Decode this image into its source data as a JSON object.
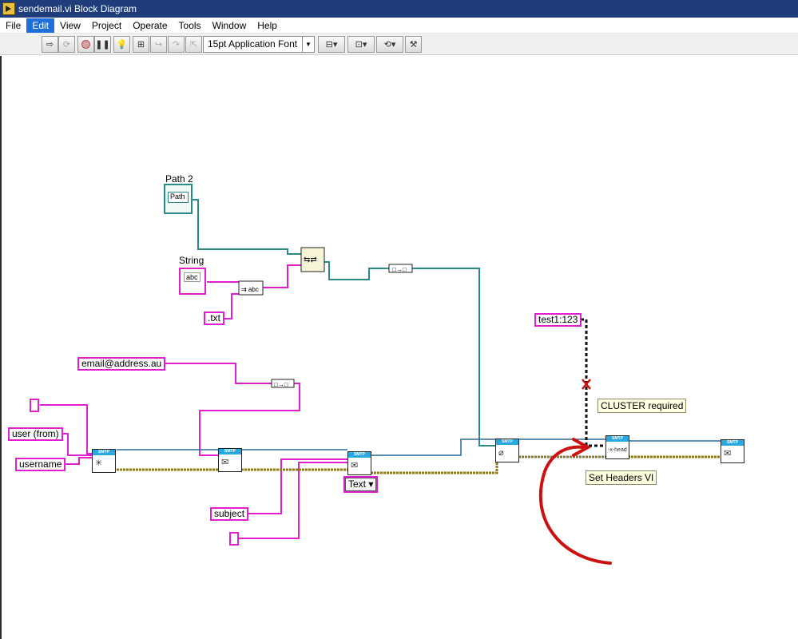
{
  "window": {
    "title": "sendemail.vi Block Diagram"
  },
  "menu": [
    "File",
    "Edit",
    "View",
    "Project",
    "Operate",
    "Tools",
    "Window",
    "Help"
  ],
  "menu_active": "Edit",
  "toolbar": {
    "font": "15pt Application Font"
  },
  "diagram": {
    "path_label": "Path 2",
    "path_terminal": "Path",
    "string_label": "String",
    "string_terminal": "abc",
    "txt_const": ".txt",
    "email_const": "email@address.au",
    "from_const": "user (from)",
    "username_const": "username",
    "subject_const": "subject",
    "test_const": "test1:123",
    "text_ring": "Text",
    "smtp_header": "SMTP",
    "set_headers_glyph": "-x-head",
    "tooltip_cluster": "CLUSTER required",
    "tooltip_headers": "Set Headers VI"
  },
  "colors": {
    "string_wire": "#e020d0",
    "path_wire": "#2a8a8a",
    "cluster_wire": "#8a7a2a",
    "annotation": "#cc1111"
  }
}
